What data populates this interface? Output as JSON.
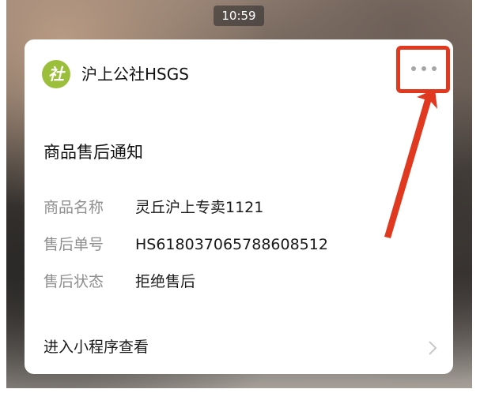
{
  "status": {
    "time": "10:59"
  },
  "card": {
    "account_name": "沪上公社HSGS",
    "logo_text": "社",
    "title": "商品售后通知",
    "fields": [
      {
        "label": "商品名称",
        "value": "灵丘沪上专卖1121"
      },
      {
        "label": "售后单号",
        "value": "HS618037065788608512"
      },
      {
        "label": "售后状态",
        "value": "拒绝售后"
      }
    ],
    "footer_link": "进入小程序查看"
  },
  "icons": {
    "more": "more-horizontal-icon",
    "chevron": "chevron-right-icon",
    "annotation": "red-arrow-annotation"
  },
  "colors": {
    "highlight_red": "#e0391f",
    "logo_green": "#9cbf3b"
  }
}
